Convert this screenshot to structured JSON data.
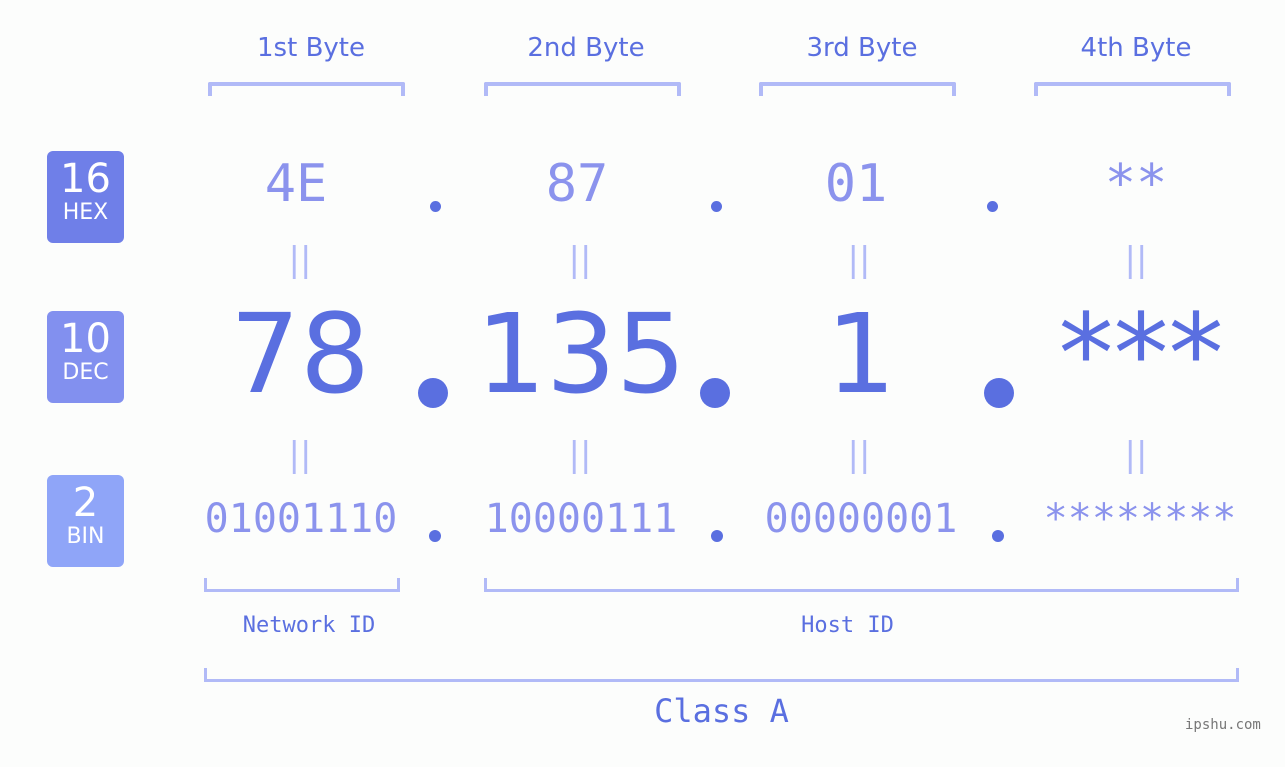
{
  "bytes": [
    {
      "header": "1st Byte",
      "hex": "4E",
      "dec": "78",
      "bin": "01001110"
    },
    {
      "header": "2nd Byte",
      "hex": "87",
      "dec": "135",
      "bin": "10000111"
    },
    {
      "header": "3rd Byte",
      "hex": "01",
      "dec": "1",
      "bin": "00000001"
    },
    {
      "header": "4th Byte",
      "hex": "**",
      "dec": "***",
      "bin": "********"
    }
  ],
  "badges": {
    "hex": {
      "number": "16",
      "label": "HEX",
      "color": "#6f7fe8"
    },
    "dec": {
      "number": "10",
      "label": "DEC",
      "color": "#8290ef"
    },
    "bin": {
      "number": "2",
      "label": "BIN",
      "color": "#8fa5f8"
    }
  },
  "equals_symbol": "||",
  "network_id_label": "Network ID",
  "host_id_label": "Host ID",
  "class_label": "Class A",
  "watermark": "ipshu.com"
}
